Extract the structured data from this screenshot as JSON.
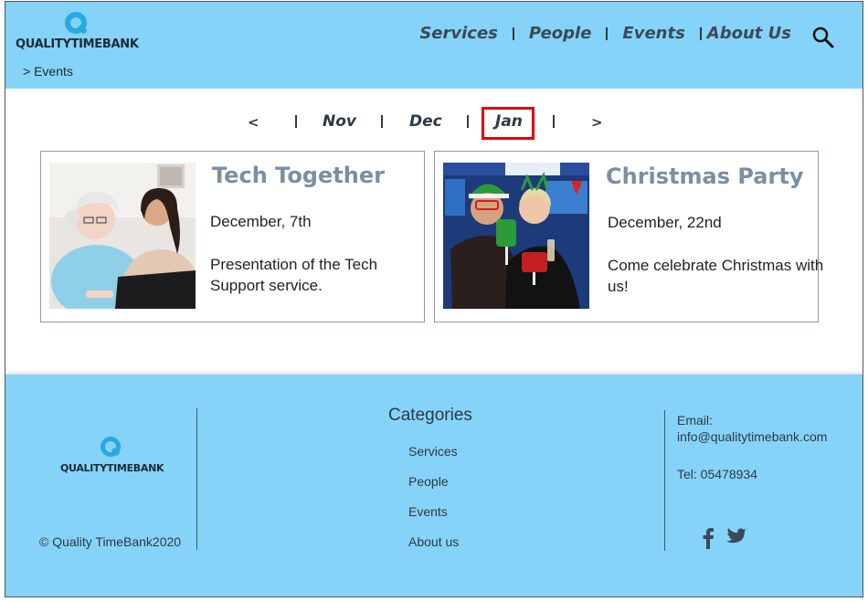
{
  "header": {
    "logo_text": "QUALITYTIMEBANK",
    "breadcrumb": "> Events",
    "nav": [
      "Services",
      "People",
      "Events",
      "About Us"
    ],
    "search_icon": "search-icon"
  },
  "months": {
    "prev": "<",
    "next": ">",
    "items": [
      "Nov",
      "Dec",
      "Jan"
    ],
    "active": "Jan",
    "highlight_color": "#e00000"
  },
  "events": [
    {
      "title": "Tech Together",
      "date": "December, 7th",
      "description": "Presentation of the Tech Support service."
    },
    {
      "title": "Christmas Party",
      "date": "December, 22nd",
      "description": "Come celebrate Christmas with us!"
    }
  ],
  "footer": {
    "logo_text": "QUALITYTIMEBANK",
    "copyright": "© Quality TimeBank2020",
    "categories_title": "Categories",
    "categories": [
      "Services",
      "People",
      "Events",
      "About us"
    ],
    "email_label": "Email:",
    "email": "info@qualitytimebank.com",
    "tel": "Tel: 05478934",
    "social_icons": [
      "facebook-icon",
      "twitter-icon"
    ]
  },
  "colors": {
    "header_bg": "#85d3f8",
    "logo_blue": "#29a9e1",
    "card_title": "#7b8ea2"
  }
}
